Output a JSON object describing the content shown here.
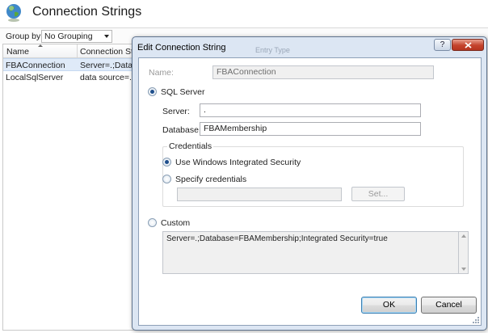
{
  "header": {
    "title": "Connection Strings",
    "icon": "globe-icon"
  },
  "toolbar": {
    "group_by_label": "Group by:",
    "group_by_value": "No Grouping"
  },
  "grid": {
    "columns": [
      "Name",
      "Connection String"
    ],
    "rows": [
      {
        "name": "FBAConnection",
        "value": "Server=.;Databas",
        "selected": true
      },
      {
        "name": "LocalSqlServer",
        "value": "data source=.\\S",
        "selected": false
      }
    ]
  },
  "dialog": {
    "title": "Edit Connection String",
    "ghost_title": "Entry Type",
    "help_label": "?",
    "name_label": "Name:",
    "name_value": "FBAConnection",
    "sql_server_label": "SQL Server",
    "sql_server_selected": true,
    "server_label": "Server:",
    "server_value": ".",
    "database_label": "Database:",
    "database_value": "FBAMembership",
    "credentials_legend": "Credentials",
    "use_windows_label": "Use Windows Integrated Security",
    "use_windows_selected": true,
    "specify_label": "Specify credentials",
    "credentials_value": "",
    "set_button": "Set...",
    "custom_label": "Custom",
    "custom_value": "Server=.;Database=FBAMembership;Integrated Security=true",
    "ok_button": "OK",
    "cancel_button": "Cancel"
  },
  "colors": {
    "dialog_frame": "#dce6f3",
    "close_button": "#c4432c",
    "selected_row": "#dfeaf8",
    "default_button_border": "#3c7fb1"
  }
}
